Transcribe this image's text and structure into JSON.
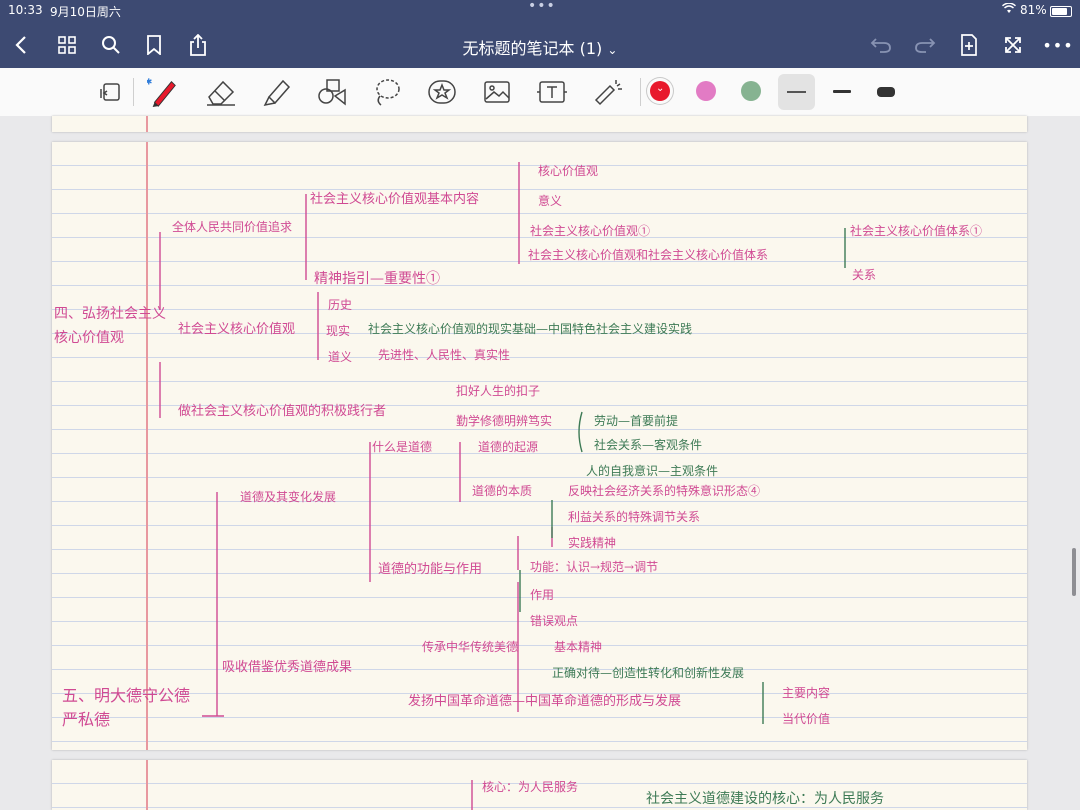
{
  "status_bar": {
    "time": "10:33",
    "date": "9月10日周六",
    "battery": "81%"
  },
  "nav": {
    "title": "无标题的笔记本 (1)",
    "title_chevron": "⌄"
  },
  "toolbar": {
    "tools": [
      "page-view-icon",
      "pen-icon",
      "eraser-icon",
      "highlighter-icon",
      "shapes-icon",
      "lasso-icon",
      "sticker-icon",
      "image-icon",
      "text-icon",
      "laser-pointer-icon"
    ],
    "colors": [
      "#e8192c",
      "#e27bc4",
      "#86b391"
    ],
    "selected_color": "#e8192c",
    "stroke_sizes": [
      "thin",
      "medium",
      "thick"
    ]
  },
  "notes": {
    "section_four": "四、弘扬社会主义\n核心价值观",
    "section_five": "五、明大德守公德\n严私德",
    "b1": "全体人民共同价值追求",
    "b1a": "社会主义核心价值观基本内容",
    "b1a1": "核心价值观",
    "b1a2": "意义",
    "b1a3": "社会主义核心价值观①",
    "b1a4": "社会主义核心价值观和社会主义核心价值体系",
    "b1a4a": "社会主义核心价值体系①",
    "b1a4b": "关系",
    "b1b": "精神指引—重要性①",
    "b2": "社会主义核心价值观",
    "b2a": "历史",
    "b2b": "现实",
    "b2c": "道义",
    "b2b_text": "社会主义核心价值观的现实基础—中国特色社会主义建设实践",
    "b2c_text": "先进性、人民性、真实性",
    "b3": "做社会主义核心价值观的积极践行者",
    "b3a": "扣好人生的扣子",
    "b3b": "勤学修德明辨笃实",
    "m1": "道德及其变化发展",
    "m1a": "什么是道德",
    "m1a1": "道德的起源",
    "m1a1a": "劳动—首要前提",
    "m1a1b": "社会关系—客观条件",
    "m1a1c": "人的自我意识—主观条件",
    "m1a2": "道德的本质",
    "m1a2a": "反映社会经济关系的特殊意识形态④",
    "m1a2b": "利益关系的特殊调节关系",
    "m1a2c": "实践精神",
    "m1b": "道德的功能与作用",
    "m1b1": "功能：认识→规范→调节",
    "m1b2": "作用",
    "m1b3": "错误观点",
    "m2": "吸收借鉴优秀道德成果",
    "m2a": "传承中华传统美德",
    "m2a1": "基本精神",
    "m2a2": "正确对待—创造性转化和创新性发展",
    "m2b": "发扬中国革命道德—中国革命道德的形成与发展",
    "m2b1": "主要内容",
    "m2b2": "当代价值",
    "p2a": "核心：为人民服务",
    "p2b": "社会主义道德建设的核心：为人民服务"
  }
}
